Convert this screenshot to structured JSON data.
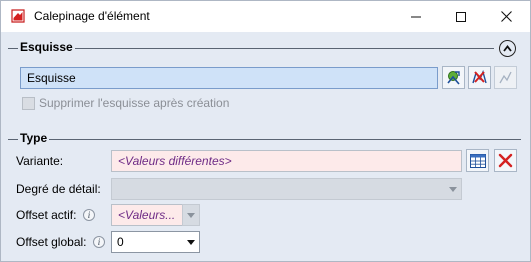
{
  "window": {
    "title": "Calepinage d'élément",
    "controls": [
      "minimize-icon",
      "maximize-icon",
      "close-icon"
    ]
  },
  "esquisse": {
    "section_title": "Esquisse",
    "input_value": "Esquisse",
    "buttons": [
      "pick-sketch-icon",
      "edit-sketch-icon",
      "disabled-sketch-icon"
    ],
    "checkbox_label": "Supprimer l'esquisse après création",
    "checkbox_checked": false
  },
  "type": {
    "section_title": "Type",
    "variante_label": "Variante:",
    "variante_value": "<Valeurs différentes>",
    "degre_label": "Degré de détail:",
    "degre_value": "",
    "offset_actif_label": "Offset actif:",
    "offset_actif_value": "<Valeurs...",
    "offset_global_label": "Offset global:",
    "offset_global_value": "0"
  }
}
